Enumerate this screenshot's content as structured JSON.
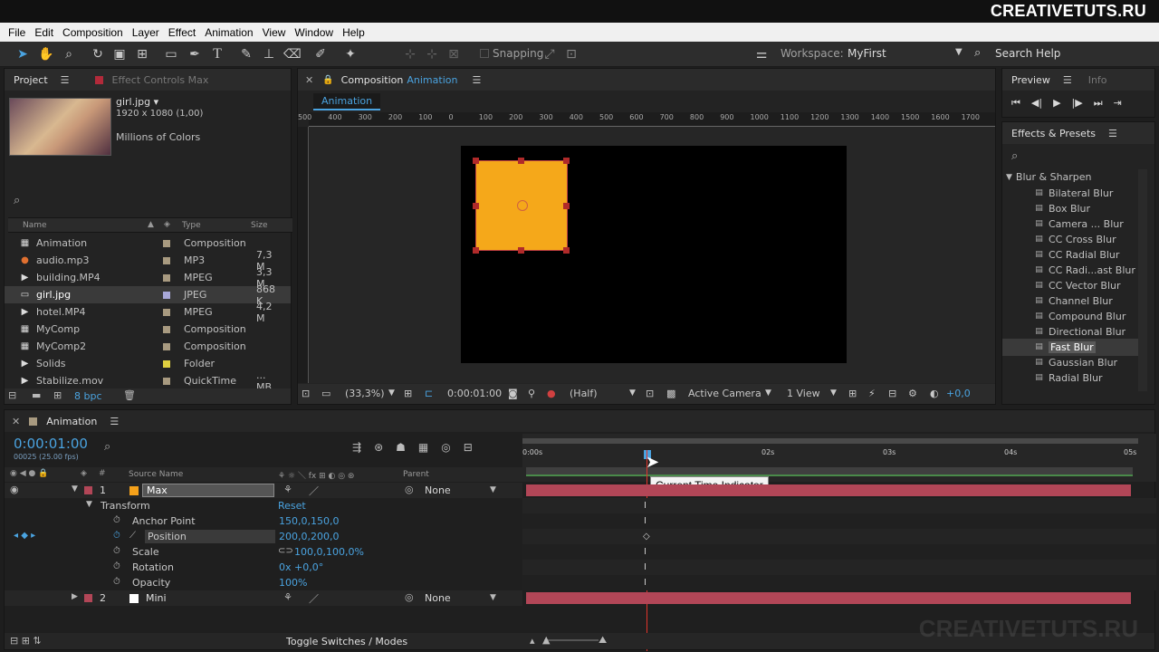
{
  "brand": "CREATIVETUTS.RU",
  "watermark": "CREATIVETUTS.RU",
  "menu": [
    "File",
    "Edit",
    "Composition",
    "Layer",
    "Effect",
    "Animation",
    "View",
    "Window",
    "Help"
  ],
  "toolbar": {
    "snapping": "Snapping",
    "workspace_label": "Workspace:",
    "workspace_value": "MyFirst",
    "search_help": "Search Help"
  },
  "project": {
    "tab": "Project",
    "effect_controls": "Effect Controls Max",
    "file_name": "girl.jpg ▾",
    "file_dims": "1920 x 1080 (1,00)",
    "file_colors": "Millions of Colors",
    "cols": {
      "name": "Name",
      "type": "Type",
      "size": "Size"
    },
    "items": [
      {
        "name": "Animation",
        "type": "Composition",
        "size": "",
        "color": "#a89a80",
        "icon": "comp-icon"
      },
      {
        "name": "audio.mp3",
        "type": "MP3",
        "size": "7,3 M",
        "color": "#a89a80",
        "icon": "audio-icon"
      },
      {
        "name": "building.MP4",
        "type": "MPEG",
        "size": "3,3 M",
        "color": "#a89a80",
        "icon": "video-icon"
      },
      {
        "name": "girl.jpg",
        "type": "JPEG",
        "size": "868 K",
        "color": "#a8a8d8",
        "icon": "image-icon"
      },
      {
        "name": "hotel.MP4",
        "type": "MPEG",
        "size": "4,2 M",
        "color": "#a89a80",
        "icon": "video-icon"
      },
      {
        "name": "MyComp",
        "type": "Composition",
        "size": "",
        "color": "#a89a80",
        "icon": "comp-icon"
      },
      {
        "name": "MyComp2",
        "type": "Composition",
        "size": "",
        "color": "#a89a80",
        "icon": "comp-icon"
      },
      {
        "name": "Solids",
        "type": "Folder",
        "size": "",
        "color": "#e0d040",
        "icon": "folder-icon"
      },
      {
        "name": "Stabilize.mov",
        "type": "QuickTime",
        "size": "... MB",
        "color": "#a89a80",
        "icon": "video-icon"
      }
    ],
    "bpc": "8 bpc"
  },
  "comp": {
    "label": "Composition",
    "name": "Animation",
    "tab": "Animation",
    "ruler": [
      "500",
      "400",
      "300",
      "200",
      "100",
      "0",
      "100",
      "200",
      "300",
      "400",
      "500",
      "600",
      "700",
      "800",
      "900",
      "1000",
      "1100",
      "1200",
      "1300",
      "1400",
      "1500",
      "1600",
      "1700"
    ],
    "zoom": "(33,3%)",
    "timecode": "0:00:01:00",
    "resolution": "(Half)",
    "camera": "Active Camera",
    "view": "1 View",
    "exposure": "+0,0"
  },
  "preview": {
    "tab": "Preview",
    "info": "Info"
  },
  "effects": {
    "tab": "Effects & Presets",
    "category": "Blur & Sharpen",
    "items": [
      "Bilateral Blur",
      "Box Blur",
      "Camera ... Blur",
      "CC Cross Blur",
      "CC Radial Blur",
      "CC Radi...ast Blur",
      "CC Vector Blur",
      "Channel Blur",
      "Compound Blur",
      "Directional Blur",
      "Fast Blur",
      "Gaussian Blur",
      "Radial Blur"
    ],
    "selected": "Fast Blur"
  },
  "timeline": {
    "tab": "Animation",
    "time": "0:00:01:00",
    "fps": "00025 (25.00 fps)",
    "col_source": "Source Name",
    "col_parent": "Parent",
    "time_labels": [
      "0:00s",
      "02s",
      "03s",
      "04s",
      "05s"
    ],
    "tooltip": "Current Time Indicator",
    "toggle": "Toggle Switches / Modes",
    "layers": [
      {
        "num": "1",
        "name": "Max",
        "color": "#f5a11a",
        "parent": "None"
      },
      {
        "num": "2",
        "name": "Mini",
        "color": "#ffffff",
        "parent": "None"
      }
    ],
    "transform": "Transform",
    "reset": "Reset",
    "props": [
      {
        "name": "Anchor Point",
        "value": "150,0,150,0"
      },
      {
        "name": "Position",
        "value": "200,0,200,0"
      },
      {
        "name": "Scale",
        "value": "100,0,100,0%"
      },
      {
        "name": "Rotation",
        "value": "0x +0,0°"
      },
      {
        "name": "Opacity",
        "value": "100%"
      }
    ]
  },
  "colors": {
    "accent": "#4aa3e0",
    "layer_bar": "#b24657",
    "solid": "#f5a81a",
    "cti": "#e0352b"
  }
}
